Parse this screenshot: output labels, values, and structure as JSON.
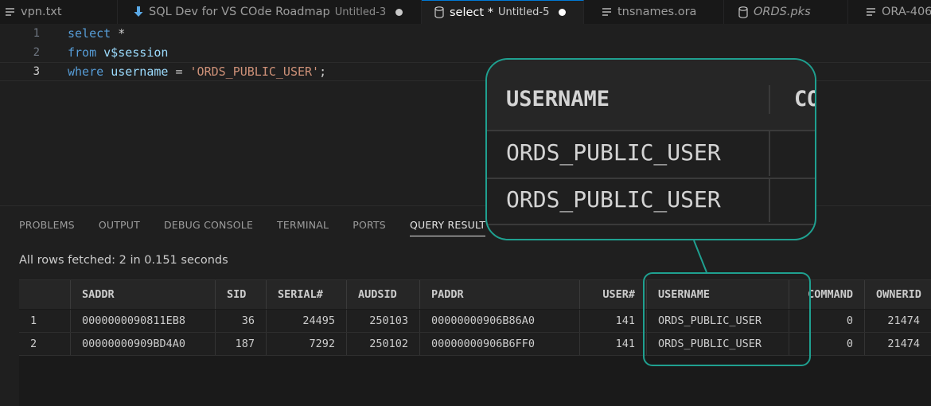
{
  "tabs": [
    {
      "label": "vpn.txt",
      "icon": "text-file-icon"
    },
    {
      "label": "SQL Dev for VS COde Roadmap",
      "sub": "Untitled-3",
      "icon": "download-arrow-icon"
    },
    {
      "label": "select *",
      "sub": "Untitled-5",
      "icon": "database-icon",
      "active": true
    },
    {
      "label": "tnsnames.ora",
      "icon": "text-file-icon"
    },
    {
      "label": "ORDS.pks",
      "icon": "database-icon"
    },
    {
      "label": "ORA-406",
      "icon": "text-file-icon"
    }
  ],
  "editor": {
    "line_numbers": [
      "1",
      "2",
      "3"
    ],
    "line1": {
      "kw": "select",
      "rest": " *"
    },
    "line2": {
      "kw": "from",
      "id": "v$session"
    },
    "line3": {
      "kw": "where",
      "id": "username",
      "op": " = ",
      "str": "'ORDS_PUBLIC_USER'",
      "end": ";"
    }
  },
  "panel": {
    "tabs": [
      "PROBLEMS",
      "OUTPUT",
      "DEBUG CONSOLE",
      "TERMINAL",
      "PORTS",
      "QUERY RESULT"
    ],
    "status": "All rows fetched: 2 in 0.151 seconds"
  },
  "grid": {
    "columns": [
      "",
      "SADDR",
      "SID",
      "SERIAL#",
      "AUDSID",
      "PADDR",
      "USER#",
      "USERNAME",
      "COMMAND",
      "OWNERID"
    ],
    "rows": [
      [
        "1",
        "0000000090811EB8",
        "36",
        "24495",
        "250103",
        "00000000906B86A0",
        "141",
        "ORDS_PUBLIC_USER",
        "0",
        "21474"
      ],
      [
        "2",
        "00000000909BD4A0",
        "187",
        "7292",
        "250102",
        "00000000906B6FF0",
        "141",
        "ORDS_PUBLIC_USER",
        "0",
        "21474"
      ]
    ]
  },
  "zoom": {
    "header": "USERNAME",
    "header_next": "CO",
    "values": [
      "ORDS_PUBLIC_USER",
      "ORDS_PUBLIC_USER"
    ]
  },
  "colors": {
    "highlight": "#1fa090",
    "keyword": "#569cd6",
    "string": "#ce9178",
    "identifier": "#9cdcfe"
  }
}
